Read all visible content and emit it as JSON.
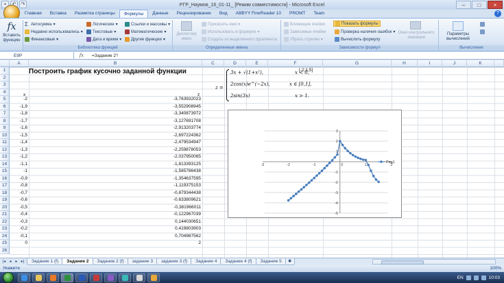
{
  "window": {
    "title": "РГР_Наумов_16_01-11_ [Режим совместимости] - Microsoft Excel",
    "controls": [
      "–",
      "□",
      "×"
    ]
  },
  "ribbon_tabs": [
    "Главная",
    "Вставка",
    "Разметка страницы",
    "Формулы",
    "Данные",
    "Рецензирование",
    "Вид",
    "ABBYY FineReader 10",
    "PROMT",
    "Team"
  ],
  "active_tab": "Формулы",
  "ribbon": {
    "insert_function": "Вставить функцию",
    "library": {
      "title": "Библиотека функций",
      "items": [
        "Автосумма",
        "Недавно использовались",
        "Финансовые",
        "Логические",
        "Текстовые",
        "Дата и время",
        "Ссылки и массивы",
        "Математические",
        "Другие функции"
      ]
    },
    "names": {
      "title": "Определенные имена",
      "manager": "Диспетчер имен",
      "items": [
        "Присвоить имя",
        "Использовать в формуле",
        "Создать из выделенного фрагмента"
      ]
    },
    "audit": {
      "title": "Зависимости формул",
      "items": [
        "Влияющие ячейки",
        "Показать формулы",
        "Зависимые ячейки",
        "Проверка наличия ошибок",
        "Убрать стрелки",
        "Вычислить формулу"
      ],
      "watch": "Окно контрольного значения"
    },
    "calc": {
      "title": "Вычисление",
      "options": "Параметры вычислений"
    }
  },
  "formula_bar": {
    "name_box": "E9P",
    "formula": "=Задание 2'!"
  },
  "columns": [
    "A",
    "B",
    "C",
    "D",
    "E",
    "F",
    "G",
    "H",
    "I",
    "J",
    "K"
  ],
  "rows": [
    "1",
    "2",
    "3",
    "4",
    "5",
    "6",
    "7",
    "8",
    "9",
    "10",
    "11",
    "12",
    "13",
    "14",
    "15",
    "16",
    "17",
    "18",
    "19",
    "20",
    "21",
    "22",
    "23",
    "24",
    "25",
    "26"
  ],
  "sheet": {
    "title": "Построить график кусочно заданной функции",
    "range_note": "[-2;1,5]",
    "header_x": "x",
    "header_z": "z",
    "formula": {
      "lhs": "z =",
      "line1": "3x + √(1+x²),",
      "line2": "2cos(x)e^(−2x),",
      "line3": "2sin(3x)",
      "cond1": "x < 0,",
      "cond2": "x ∈ [0,1],",
      "cond3": "x > 1."
    },
    "data": [
      {
        "x": "-2",
        "z": "-3,763932023"
      },
      {
        "x": "-1,9",
        "z": "-3,552908945"
      },
      {
        "x": "-1,8",
        "z": "-3,340873972"
      },
      {
        "x": "-1,7",
        "z": "-3,127691708"
      },
      {
        "x": "-1,6",
        "z": "-2,913203774"
      },
      {
        "x": "-1,5",
        "z": "-2,697224362"
      },
      {
        "x": "-1,4",
        "z": "-2,479534947"
      },
      {
        "x": "-1,3",
        "z": "-2,259878053"
      },
      {
        "x": "-1,2",
        "z": "-2,037950065"
      },
      {
        "x": "-1,1",
        "z": "-1,813393125"
      },
      {
        "x": "-1",
        "z": "-1,585786438"
      },
      {
        "x": "-0,9",
        "z": "-1,354637595"
      },
      {
        "x": "-0,8",
        "z": "-1,119375153"
      },
      {
        "x": "-0,7",
        "z": "-0,879344438"
      },
      {
        "x": "-0,6",
        "z": "-0,633809621"
      },
      {
        "x": "-0,5",
        "z": "-0,381966011"
      },
      {
        "x": "-0,4",
        "z": "-0,122967039"
      },
      {
        "x": "-0,3",
        "z": "0,144030651"
      },
      {
        "x": "-0,2",
        "z": "0,419803903"
      },
      {
        "x": "-0,1",
        "z": "0,704987562"
      },
      {
        "x": "0",
        "z": "2"
      }
    ]
  },
  "chart_data": {
    "type": "scatter",
    "legend": "Ряд1",
    "legend_position": "right",
    "xlim": [
      -3,
      2
    ],
    "ylim": [
      -5,
      3
    ],
    "x_ticks": [
      "-3",
      "-2",
      "-1",
      "0",
      "1",
      "2"
    ],
    "y_ticks": [
      "3",
      "2",
      "1",
      "0",
      "-1",
      "-2",
      "-3",
      "-4",
      "-5"
    ],
    "grid": true,
    "color": "#4a7ebb",
    "series": [
      {
        "name": "Ряд1",
        "x": [
          -2,
          -1.9,
          -1.8,
          -1.7,
          -1.6,
          -1.5,
          -1.4,
          -1.3,
          -1.2,
          -1.1,
          -1,
          -0.9,
          -0.8,
          -0.7,
          -0.6,
          -0.5,
          -0.4,
          -0.3,
          -0.2,
          -0.1,
          0,
          0.1,
          0.2,
          0.3,
          0.4,
          0.5,
          0.6,
          0.7,
          0.8,
          0.9,
          1,
          1.1,
          1.2,
          1.3,
          1.4,
          1.5
        ],
        "y": [
          -3.76,
          -3.55,
          -3.34,
          -3.13,
          -2.91,
          -2.7,
          -2.48,
          -2.26,
          -2.04,
          -1.81,
          -1.59,
          -1.35,
          -1.12,
          -0.88,
          -0.63,
          -0.38,
          -0.12,
          0.14,
          0.42,
          0.7,
          2.0,
          1.63,
          1.31,
          1.05,
          0.83,
          0.65,
          0.5,
          0.38,
          0.28,
          0.2,
          0.16,
          -0.32,
          -0.88,
          -1.39,
          -1.74,
          -1.96
        ]
      }
    ]
  },
  "sheet_tabs": [
    "Задание 1 (f)",
    "Задание 2",
    "Задание 2 (f)",
    "задание 3",
    "задание 3 (f)",
    "Задание 4",
    "Задание 4 (f)",
    "Задание 5"
  ],
  "active_sheet": "Задание 2",
  "status": {
    "mode": "Укажите",
    "zoom": "100%"
  },
  "taskbar": {
    "lang": "EN",
    "time": "10:03",
    "apps": [
      "ie",
      "explorer",
      "media",
      "excel",
      "word",
      "app6",
      "app7",
      "app8",
      "app9",
      "app10"
    ]
  }
}
